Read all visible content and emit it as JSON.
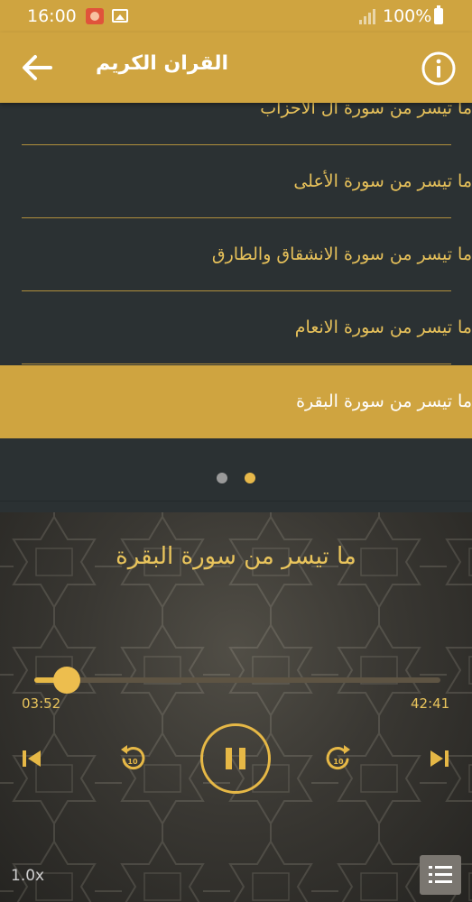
{
  "status_bar": {
    "time": "16:00",
    "battery": "100%"
  },
  "app_bar": {
    "title": "القران الكريم",
    "back_icon": "arrow-left-icon",
    "info_icon": "info-icon"
  },
  "list": {
    "items": [
      {
        "label": "ما تيسر من سورة آل الأحزاب",
        "active": false
      },
      {
        "label": "ما تيسر من سورة الأعلى",
        "active": false
      },
      {
        "label": "ما تيسر من سورة الانشقاق والطارق",
        "active": false
      },
      {
        "label": "ما تيسر من سورة الانعام",
        "active": false
      },
      {
        "label": "ما تيسر من سورة البقرة",
        "active": true
      }
    ]
  },
  "pager": {
    "pages": 2,
    "current": 2
  },
  "player": {
    "title": "ما تيسر من سورة البقرة",
    "elapsed": "03:52",
    "duration": "42:41",
    "progress": 0.08,
    "speed": "1.0x",
    "state": "playing"
  },
  "colors": {
    "accent": "#cfa440",
    "accent_text": "#e9c45c",
    "list_bg": "#2b3133"
  }
}
